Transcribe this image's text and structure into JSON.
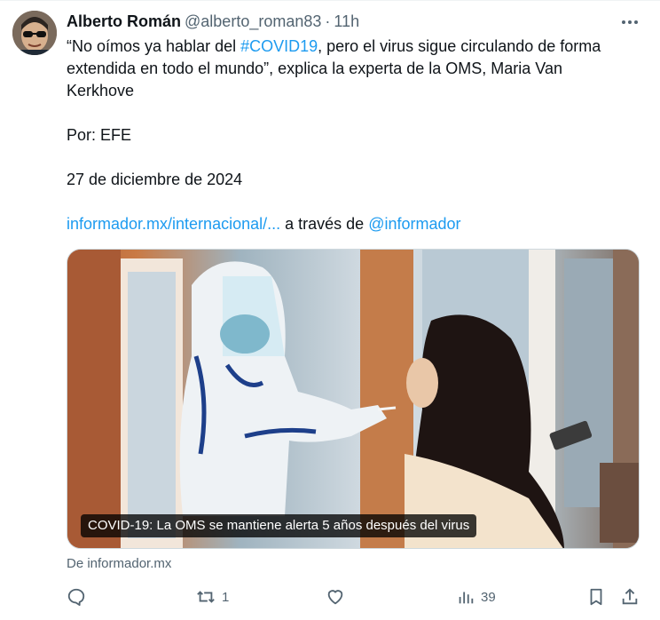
{
  "tweet": {
    "author_name": "Alberto Román",
    "author_handle": "@alberto_roman83",
    "separator": "·",
    "time": "11h",
    "text": {
      "quote_open": "“No oímos ya hablar del ",
      "hashtag": "#COVID19",
      "quote_rest_1": ", pero el virus sigue circulando de forma",
      "line2": "extendida en todo el mundo”, explica la experta de la OMS, Maria Van",
      "line3": "Kerkhove",
      "source_line": "Por: EFE",
      "date_line": "27 de diciembre de 2024",
      "url": "informador.mx/internacional/...",
      "via": " a través de ",
      "mention": "@informador"
    },
    "card": {
      "title": "COVID-19: La OMS se mantiene alerta 5 años después del virus",
      "domain": "De informador.mx"
    },
    "actions": {
      "retweets": "1",
      "views": "39"
    }
  },
  "colors": {
    "text": "#0f1419",
    "muted": "#536471",
    "link": "#1d9bf0",
    "border": "#cfd9de"
  },
  "icons": [
    "more-icon",
    "reply-icon",
    "retweet-icon",
    "like-icon",
    "views-icon",
    "bookmark-icon",
    "share-icon"
  ]
}
